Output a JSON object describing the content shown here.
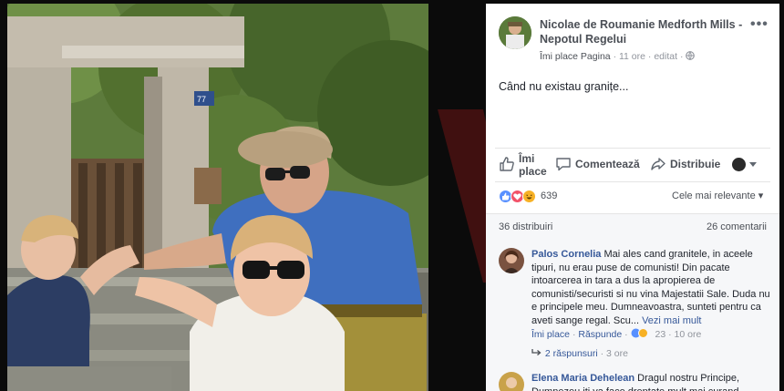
{
  "post": {
    "page_name": "Nicolae de Roumanie Medforth Mills - Nepotul Regelui",
    "like_page": "Îmi place Pagina",
    "separator": "·",
    "time": "11 ore",
    "edited": "editat",
    "text": "Când nu existau granițe..."
  },
  "photo": {
    "house_number": "77"
  },
  "actions": {
    "like_line1": "Îmi",
    "like_line2": "place",
    "comment": "Comentează",
    "share": "Distribuie"
  },
  "reactions": {
    "count": "639",
    "sort": "Cele mai relevante ▾"
  },
  "stats": {
    "shares": "36 distribuiri",
    "comments": "26 comentarii"
  },
  "comments": [
    {
      "author": "Palos Cornelia",
      "text": " Mai ales cand granitele, in aceele tipuri, nu erau puse de comunisti! Din pacate intoarcerea in tara a dus la apropierea de comunisti/securisti si nu vina Majestatii Sale. Duda nu e principele meu. Dumneavoastra, sunteti pentru ca aveti sange regal. Scu... ",
      "more": "Vezi mai mult",
      "like": "Îmi place",
      "reply": "Răspunde",
      "reactions": "23",
      "time": "10 ore",
      "replies": "2 răspunsuri",
      "replies_time": "3 ore"
    },
    {
      "author": "Elena Maria Dehelean",
      "text": " Dragul nostru Principe, Dumnezeu iti va face dreptate mult mai curand"
    }
  ],
  "colors": {
    "link": "#365899",
    "grey_text": "#90949c",
    "like_blue": "#5890ff",
    "love_red": "#f25268",
    "haha_yellow": "#f7b125"
  }
}
